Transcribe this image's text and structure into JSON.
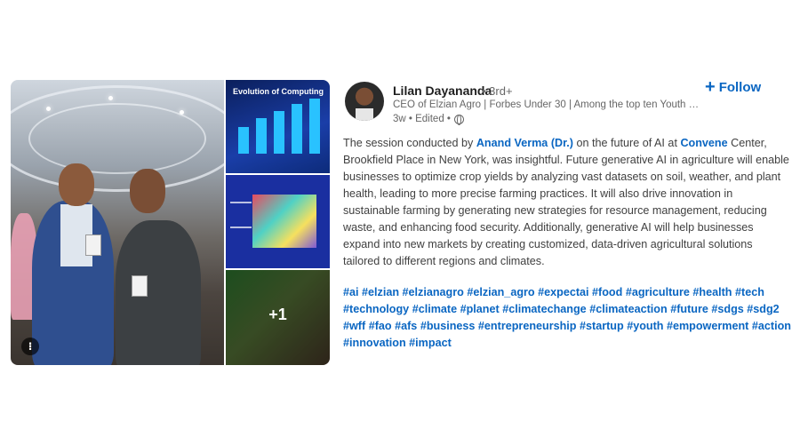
{
  "author": {
    "name": "Lilan Dayananda",
    "degree": "• 3rd+",
    "headline": "CEO of Elzian Agro | Forbes Under 30 | Among the top ten Youth So...",
    "meta": "3w • Edited •",
    "follow_label": "Follow"
  },
  "gallery": {
    "evolution_slide_title": "Evolution of Computing",
    "more_count": "+1"
  },
  "post": {
    "part1": "The session conducted by ",
    "mention_person": "Anand Verma (Dr.)",
    "part2": " on the future of AI at ",
    "mention_place": "Convene",
    "part3": " Center, Brookfield Place in New York, was insightful. Future generative AI in agriculture will enable businesses to optimize crop yields by analyzing vast datasets on soil, weather, and plant health, leading to more precise farming practices. It will also drive innovation in sustainable farming by generating new strategies for resource management, reducing waste, and enhancing food security. Additionally, generative AI will help businesses expand into new markets by creating customized, data-driven agricultural solutions tailored to different regions and climates."
  },
  "hashtags": [
    "#ai",
    "#elzian",
    "#elzianagro",
    "#elzian_agro",
    "#expectai",
    "#food",
    "#agriculture",
    "#health",
    "#tech",
    "#technology",
    "#climate",
    "#planet",
    "#climatechange",
    "#climateaction",
    "#future",
    "#sdgs",
    "#sdg2",
    "#wff",
    "#fao",
    "#afs",
    "#business",
    "#entrepreneurship",
    "#startup",
    "#youth",
    "#empowerment",
    "#action",
    "#innovation",
    "#impact"
  ],
  "colors": {
    "link": "#0a66c2",
    "text": "#404040",
    "muted": "#666666"
  },
  "icons": [
    "info-icon",
    "globe-icon",
    "plus-icon"
  ]
}
